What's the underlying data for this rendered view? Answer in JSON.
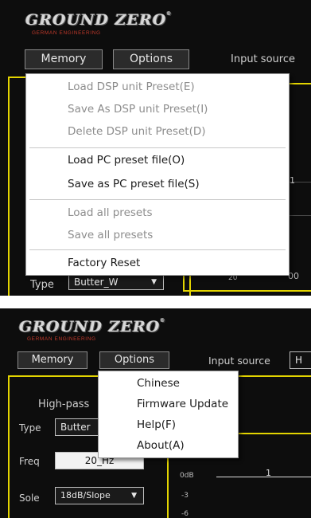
{
  "brand": {
    "logo": "GROUND ZERO",
    "registered": "®",
    "tagline": "GERMAN ENGINEERING"
  },
  "toolbar": {
    "memory": "Memory",
    "options": "Options",
    "input_source_label": "Input source",
    "input_source_value": "H"
  },
  "memory_menu": {
    "items": [
      {
        "label": "Load DSP unit Preset(E)",
        "enabled": false
      },
      {
        "label": "Save As DSP unit Preset(I)",
        "enabled": false
      },
      {
        "label": "Delete DSP unit Preset(D)",
        "enabled": false
      },
      {
        "label": "Load PC preset file(O)",
        "enabled": true
      },
      {
        "label": "Save as PC preset file(S)",
        "enabled": true
      },
      {
        "label": "Load all presets",
        "enabled": false
      },
      {
        "label": "Save all presets",
        "enabled": false
      },
      {
        "label": "Factory Reset",
        "enabled": true
      }
    ]
  },
  "options_menu": {
    "items": [
      {
        "label": "Chinese"
      },
      {
        "label": "Firmware Update"
      },
      {
        "label": "Help(F)"
      },
      {
        "label": "About(A)"
      }
    ]
  },
  "filter": {
    "section_title": "High-pass",
    "type_label": "Type",
    "type_value": "Butter_W",
    "type_value_truncated": "Butter",
    "freq_label": "Freq",
    "freq_value": "20_Hz",
    "slope_label": "Sole",
    "slope_value": "18dB/Slope",
    "dropdown_glyph": "▼"
  },
  "graph": {
    "top_panel": {
      "marker": "1",
      "tick_left": "20",
      "tick_right": "00"
    },
    "bottom_panel": {
      "marker": "1",
      "y_ticks": [
        "0dB",
        "-3",
        "-6"
      ]
    }
  },
  "colors": {
    "panel_bg": "#0d0d0d",
    "frame": "#e3d400",
    "brand_red": "#c0392b",
    "menu_bg": "#ffffff"
  }
}
